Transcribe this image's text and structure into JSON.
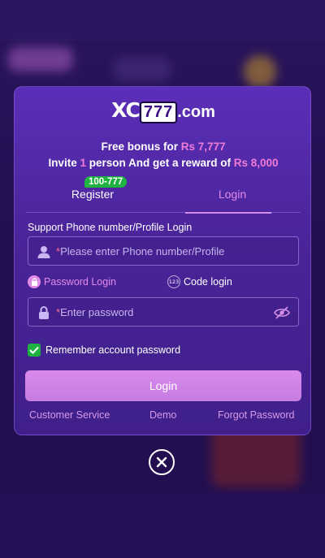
{
  "logo": {
    "part1": "XC",
    "part2": "777",
    "part3": ".com"
  },
  "promo": {
    "line1_prefix": "Free bonus for ",
    "line1_amount": "Rs 7,777",
    "line2_prefix": "Invite ",
    "line2_count": "1",
    "line2_mid": " person And get a reward of ",
    "line2_amount": "Rs 8,000"
  },
  "tabs": {
    "register": "Register",
    "login": "Login",
    "badge": "100-777"
  },
  "form": {
    "phone_label": "Support Phone number/Profile Login",
    "phone_placeholder": "Please enter Phone number/Profile",
    "required_mark": "*",
    "password_login": "Password Login",
    "code_login": "Code login",
    "code_icon_text": "123",
    "password_placeholder": "Enter password",
    "remember": "Remember account password",
    "login_button": "Login"
  },
  "footer": {
    "customer_service": "Customer Service",
    "demo": "Demo",
    "forgot": "Forgot Password"
  },
  "colors": {
    "accent": "#e08be8",
    "badge": "#1fb240",
    "modal": "#4a2499"
  },
  "icons": {
    "user": "user-icon",
    "lock": "lock-icon",
    "eye": "eye-off-icon",
    "close": "close-icon",
    "check": "check-icon"
  }
}
